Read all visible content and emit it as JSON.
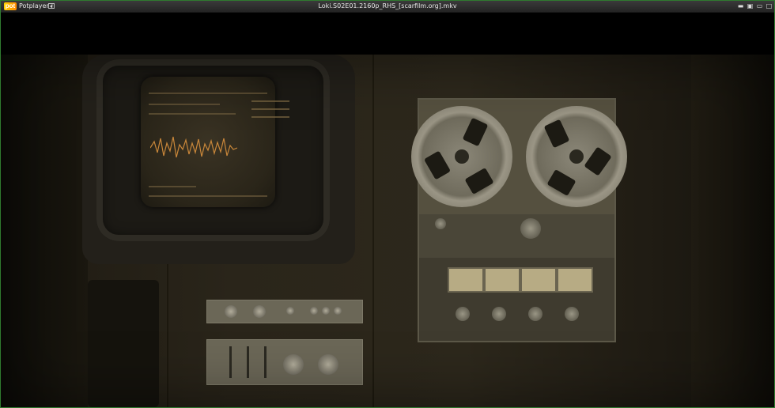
{
  "app": {
    "logo_text": "pot",
    "menu_label": "Potplayer",
    "menu_caret": "▾"
  },
  "window": {
    "title": "Loki.S02E01.2160p_RHS_[scarfilm.org].mkv"
  },
  "controls": {
    "minimize_glyph": "▬",
    "restore_glyph": "▣",
    "min2_glyph": "▭",
    "close_glyph": "□"
  },
  "colors": {
    "accent_border": "#2f7a2f",
    "titlebar_bg": "#2b2b2b"
  }
}
